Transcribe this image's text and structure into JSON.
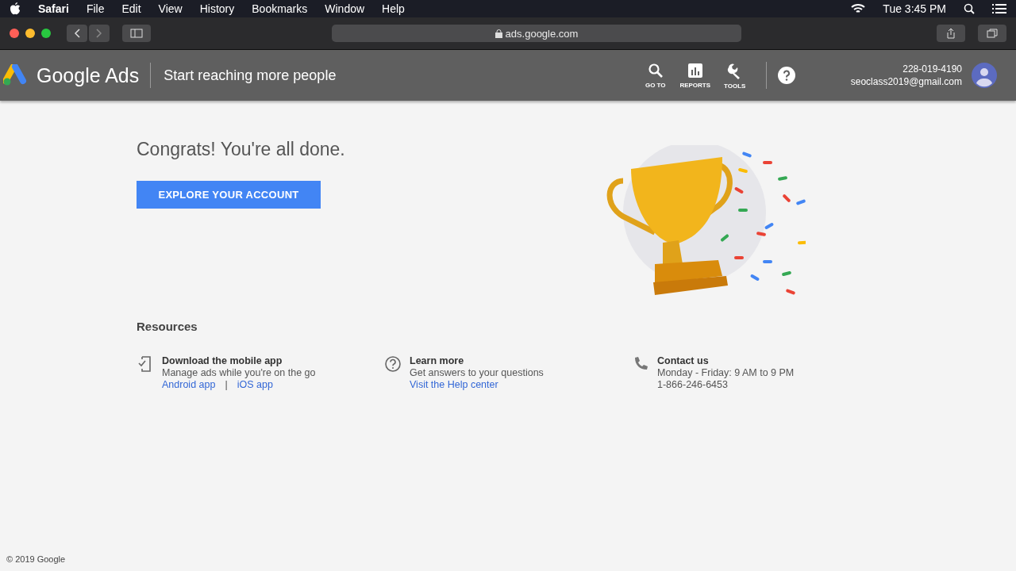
{
  "menu_bar": {
    "app": "Safari",
    "items": [
      "File",
      "Edit",
      "View",
      "History",
      "Bookmarks",
      "Window",
      "Help"
    ],
    "clock": "Tue 3:45 PM"
  },
  "browser": {
    "url": "ads.google.com"
  },
  "header": {
    "brand": "Google Ads",
    "subtitle": "Start reaching more people",
    "tools": [
      {
        "kind": "search",
        "label": "GO TO"
      },
      {
        "kind": "reports",
        "label": "REPORTS"
      },
      {
        "kind": "tools",
        "label": "TOOLS"
      }
    ],
    "account_id": "228-019-4190",
    "email": "seoclass2019@gmail.com"
  },
  "main": {
    "heading": "Congrats! You're all done.",
    "button": "EXPLORE YOUR ACCOUNT"
  },
  "resources": {
    "title": "Resources",
    "items": [
      {
        "kind": "phone-app",
        "title": "Download the mobile app",
        "text": "Manage ads while you're on the go",
        "links": [
          "Android app",
          "iOS app"
        ],
        "separator": "|"
      },
      {
        "kind": "help",
        "title": "Learn more",
        "text": "Get answers to your questions",
        "links": [
          "Visit the Help center"
        ]
      },
      {
        "kind": "call",
        "title": "Contact us",
        "text": "Monday - Friday: 9 AM to 9 PM",
        "extra": "1-866-246-6453"
      }
    ]
  },
  "footer": "© 2019 Google"
}
